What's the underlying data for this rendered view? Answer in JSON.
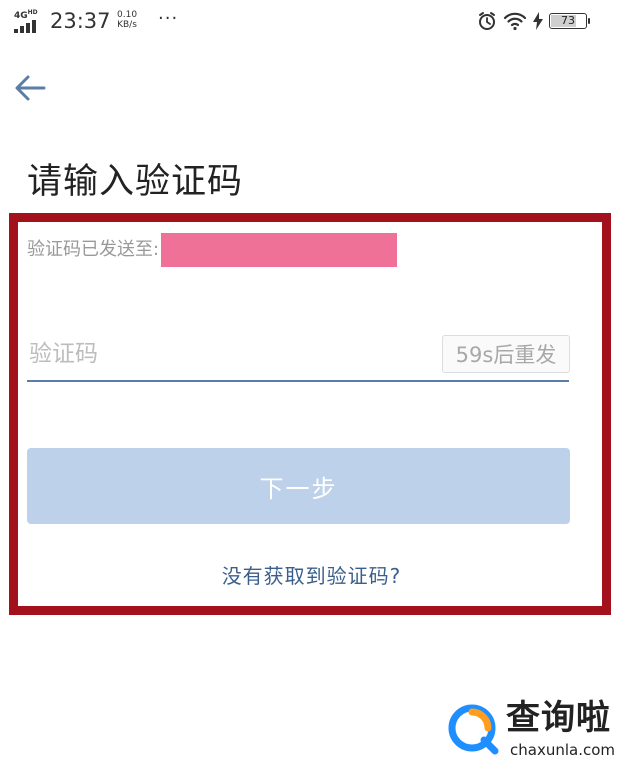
{
  "status_bar": {
    "network": "4G",
    "network_sup": "HD",
    "time": "23:37",
    "speed_value": "0.10",
    "speed_unit": "KB/s",
    "dots": "···",
    "battery": "73"
  },
  "header": {
    "title": "请输入验证码"
  },
  "form": {
    "sent_label": "验证码已发送至:",
    "code_placeholder": "验证码",
    "code_value": "",
    "resend_label": "59s后重发",
    "next_label": "下一步",
    "no_code_link": "没有获取到验证码?"
  },
  "watermark": {
    "title": "查询啦",
    "url": "chaxunla.com"
  },
  "colors": {
    "accent": "#3b5f8c",
    "button_disabled": "#bdd1ea",
    "highlight_border": "#a3121c",
    "redaction": "#f07197"
  }
}
